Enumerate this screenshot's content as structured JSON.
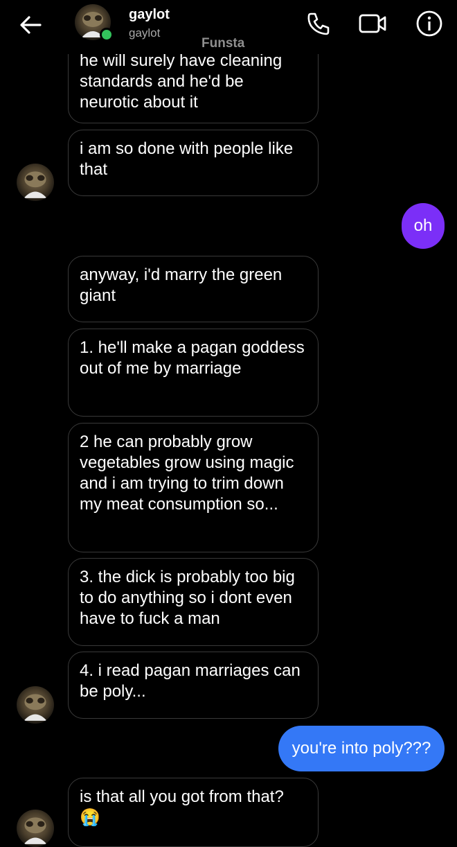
{
  "header": {
    "name": "gaylot",
    "username": "gaylot",
    "watermark": "Funsta",
    "back_icon": "arrow-left-icon",
    "call_icon": "phone-icon",
    "video_icon": "video-camera-icon",
    "info_icon": "info-icon",
    "online_color": "#33c35c"
  },
  "messages": [
    {
      "from": "them",
      "text": "he will surely have cleaning standards and he'd be neurotic about it"
    },
    {
      "from": "them",
      "text": "i am so done with people like that"
    },
    {
      "from": "me",
      "text": "oh",
      "color": "#7b2ff7"
    },
    {
      "from": "them",
      "text": "anyway, i'd marry the green giant"
    },
    {
      "from": "them",
      "text": "1. he'll make a pagan goddess out of me by marriage"
    },
    {
      "from": "them",
      "text": "2  he can probably grow vegetables grow using magic and i am trying to trim down my meat consumption so..."
    },
    {
      "from": "them",
      "text": "3. the dick is probably too big to do anything so i dont even have to fuck a man"
    },
    {
      "from": "them",
      "text": "4. i read pagan marriages can be poly..."
    },
    {
      "from": "me",
      "text": "you're into poly???",
      "color": "#3478f6"
    },
    {
      "from": "them",
      "text": "is that all you got from that?",
      "emoji": "😭"
    }
  ]
}
